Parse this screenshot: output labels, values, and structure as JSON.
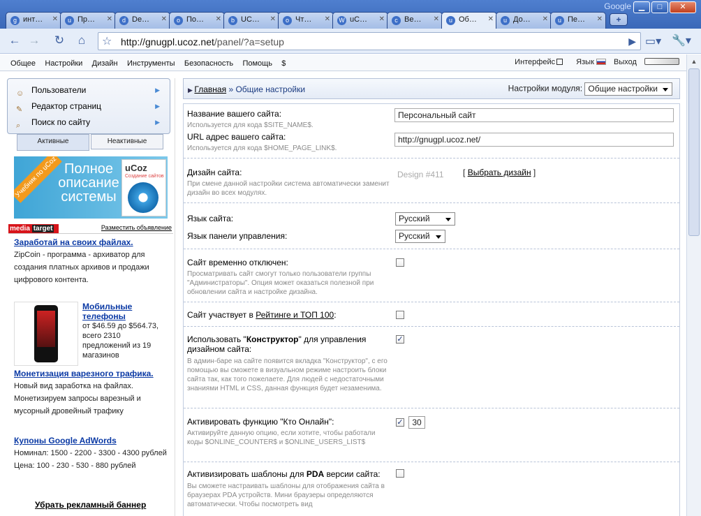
{
  "window": {
    "google_brand": "Google",
    "tabs": [
      {
        "label": "инт…",
        "fav": "g",
        "active": false
      },
      {
        "label": "Пр…",
        "fav": "u",
        "active": false
      },
      {
        "label": "De…",
        "fav": "d",
        "active": false
      },
      {
        "label": "По…",
        "fav": "o",
        "active": false
      },
      {
        "label": "UC…",
        "fav": "b",
        "active": false
      },
      {
        "label": "Чт…",
        "fav": "o",
        "active": false
      },
      {
        "label": "uC…",
        "fav": "W",
        "active": false
      },
      {
        "label": "Ве…",
        "fav": "c",
        "active": false
      },
      {
        "label": "Об…",
        "fav": "u",
        "active": true
      },
      {
        "label": "До…",
        "fav": "u",
        "active": false
      },
      {
        "label": "Пе…",
        "fav": "u",
        "active": false
      }
    ]
  },
  "toolbar": {
    "url_host": "http://gnugpl.ucoz.net",
    "url_path": "/panel/?a=setup"
  },
  "adminbar": {
    "menu": [
      "Общее",
      "Настройки",
      "Дизайн",
      "Инструменты",
      "Безопасность",
      "Помощь",
      "$"
    ],
    "interface_label": "Интерфейс",
    "language_label": "Язык",
    "logout_label": "Выход"
  },
  "sidebar": {
    "items": [
      {
        "label": "Пользователи",
        "icon": "user-icon"
      },
      {
        "label": "Редактор страниц",
        "icon": "page-editor-icon"
      },
      {
        "label": "Поиск по сайту",
        "icon": "search-icon"
      }
    ],
    "tabs": [
      "Активные",
      "Неактивные"
    ]
  },
  "banner": {
    "ribbon": "Учебник по uCoz",
    "title": "Полное описание системы",
    "box_logo": "uCoz",
    "box_sub": "Создание сайтов"
  },
  "ads": {
    "network": {
      "a": "media",
      "b": "target"
    },
    "place_ad": "Разместить объявление",
    "items": [
      {
        "title": "Заработай на своих файлах.",
        "body": "ZipCoin - программа - архиватор для создания платных архивов и продажи цифрового контента."
      },
      {
        "title": "Мобильные телефоны",
        "body": "от $46.59 до $564.73, всего 2310 предложений из 19 магазинов"
      },
      {
        "title": "Монетизация варезного трафика.",
        "body": "Новый вид заработка на файлах. Монетизируем запросы варезный и мусорный дровейный трафику"
      },
      {
        "title": "Купоны Google AdWords",
        "body": "Номинал: 1500 - 2200 - 3300 - 4300 рублей Цена: 100 - 230 - 530 - 880 рублей"
      }
    ],
    "remove_banner": "Убрать рекламный баннер"
  },
  "main": {
    "breadcrumb_home": "Главная",
    "breadcrumb_sep": " » ",
    "breadcrumb_current": "Общие настройки",
    "module_settings_label": "Настройки модуля:",
    "module_settings_value": "Общие настройки",
    "fields": {
      "site_name": {
        "label": "Название вашего сайта:",
        "hint": "Используется для кода $SITE_NAME$.",
        "value": "Персональный сайт"
      },
      "site_url": {
        "label": "URL адрес вашего сайта:",
        "hint": "Используется для кода $HOME_PAGE_LINK$.",
        "value": "http://gnugpl.ucoz.net/"
      },
      "design": {
        "label": "Дизайн сайта:",
        "hint": "При смене данной настройки система автоматически заменит дизайн во всех модулях.",
        "value": "Design #411",
        "choose": "Выбрать дизайн",
        "bracket_open": "[",
        "bracket_close": "]"
      },
      "site_lang": {
        "label": "Язык сайта:",
        "value": "Русский"
      },
      "panel_lang": {
        "label": "Язык панели управления:",
        "value": "Русский"
      },
      "disabled": {
        "label": "Сайт временно отключен:",
        "hint": "Просматривать сайт смогут только пользователи группы \"Администраторы\". Опция может оказаться полезной при обновлении сайта и настройке дизайна.",
        "checked": false
      },
      "rating": {
        "label_pre": "Сайт участвует в ",
        "label_link": "Рейтинге и ТОП 100",
        "label_post": ":",
        "checked": false
      },
      "constructor": {
        "label_pre": "Использовать \"",
        "label_bold": "Конструктор",
        "label_post": "\" для управления дизайном сайта:",
        "hint": "В админ-баре на сайте появится вкладка \"Конструктор\", с его помощью вы сможете в визуальном режиме настроить блоки сайта так, как того пожелаете. Для людей с недостаточными знаниями HTML и CSS, данная функция будет незаменима.",
        "checked": true
      },
      "online": {
        "label": "Активировать функцию \"Кто Онлайн\":",
        "hint": "Активируйте данную опцию, если хотите, чтобы работали коды $ONLINE_COUNTER$ и $ONLINE_USERS_LIST$",
        "checked": true,
        "minutes": "30"
      },
      "pda": {
        "label_pre": "Активизировать шаблоны для ",
        "label_bold": "PDA",
        "label_post": " версии сайта:",
        "hint": "Вы сможете настраивать шаблоны для отображения сайта в браузерах PDA устройств. Мини браузеры определяются автоматически. Чтобы посмотреть вид",
        "checked": false
      }
    }
  }
}
